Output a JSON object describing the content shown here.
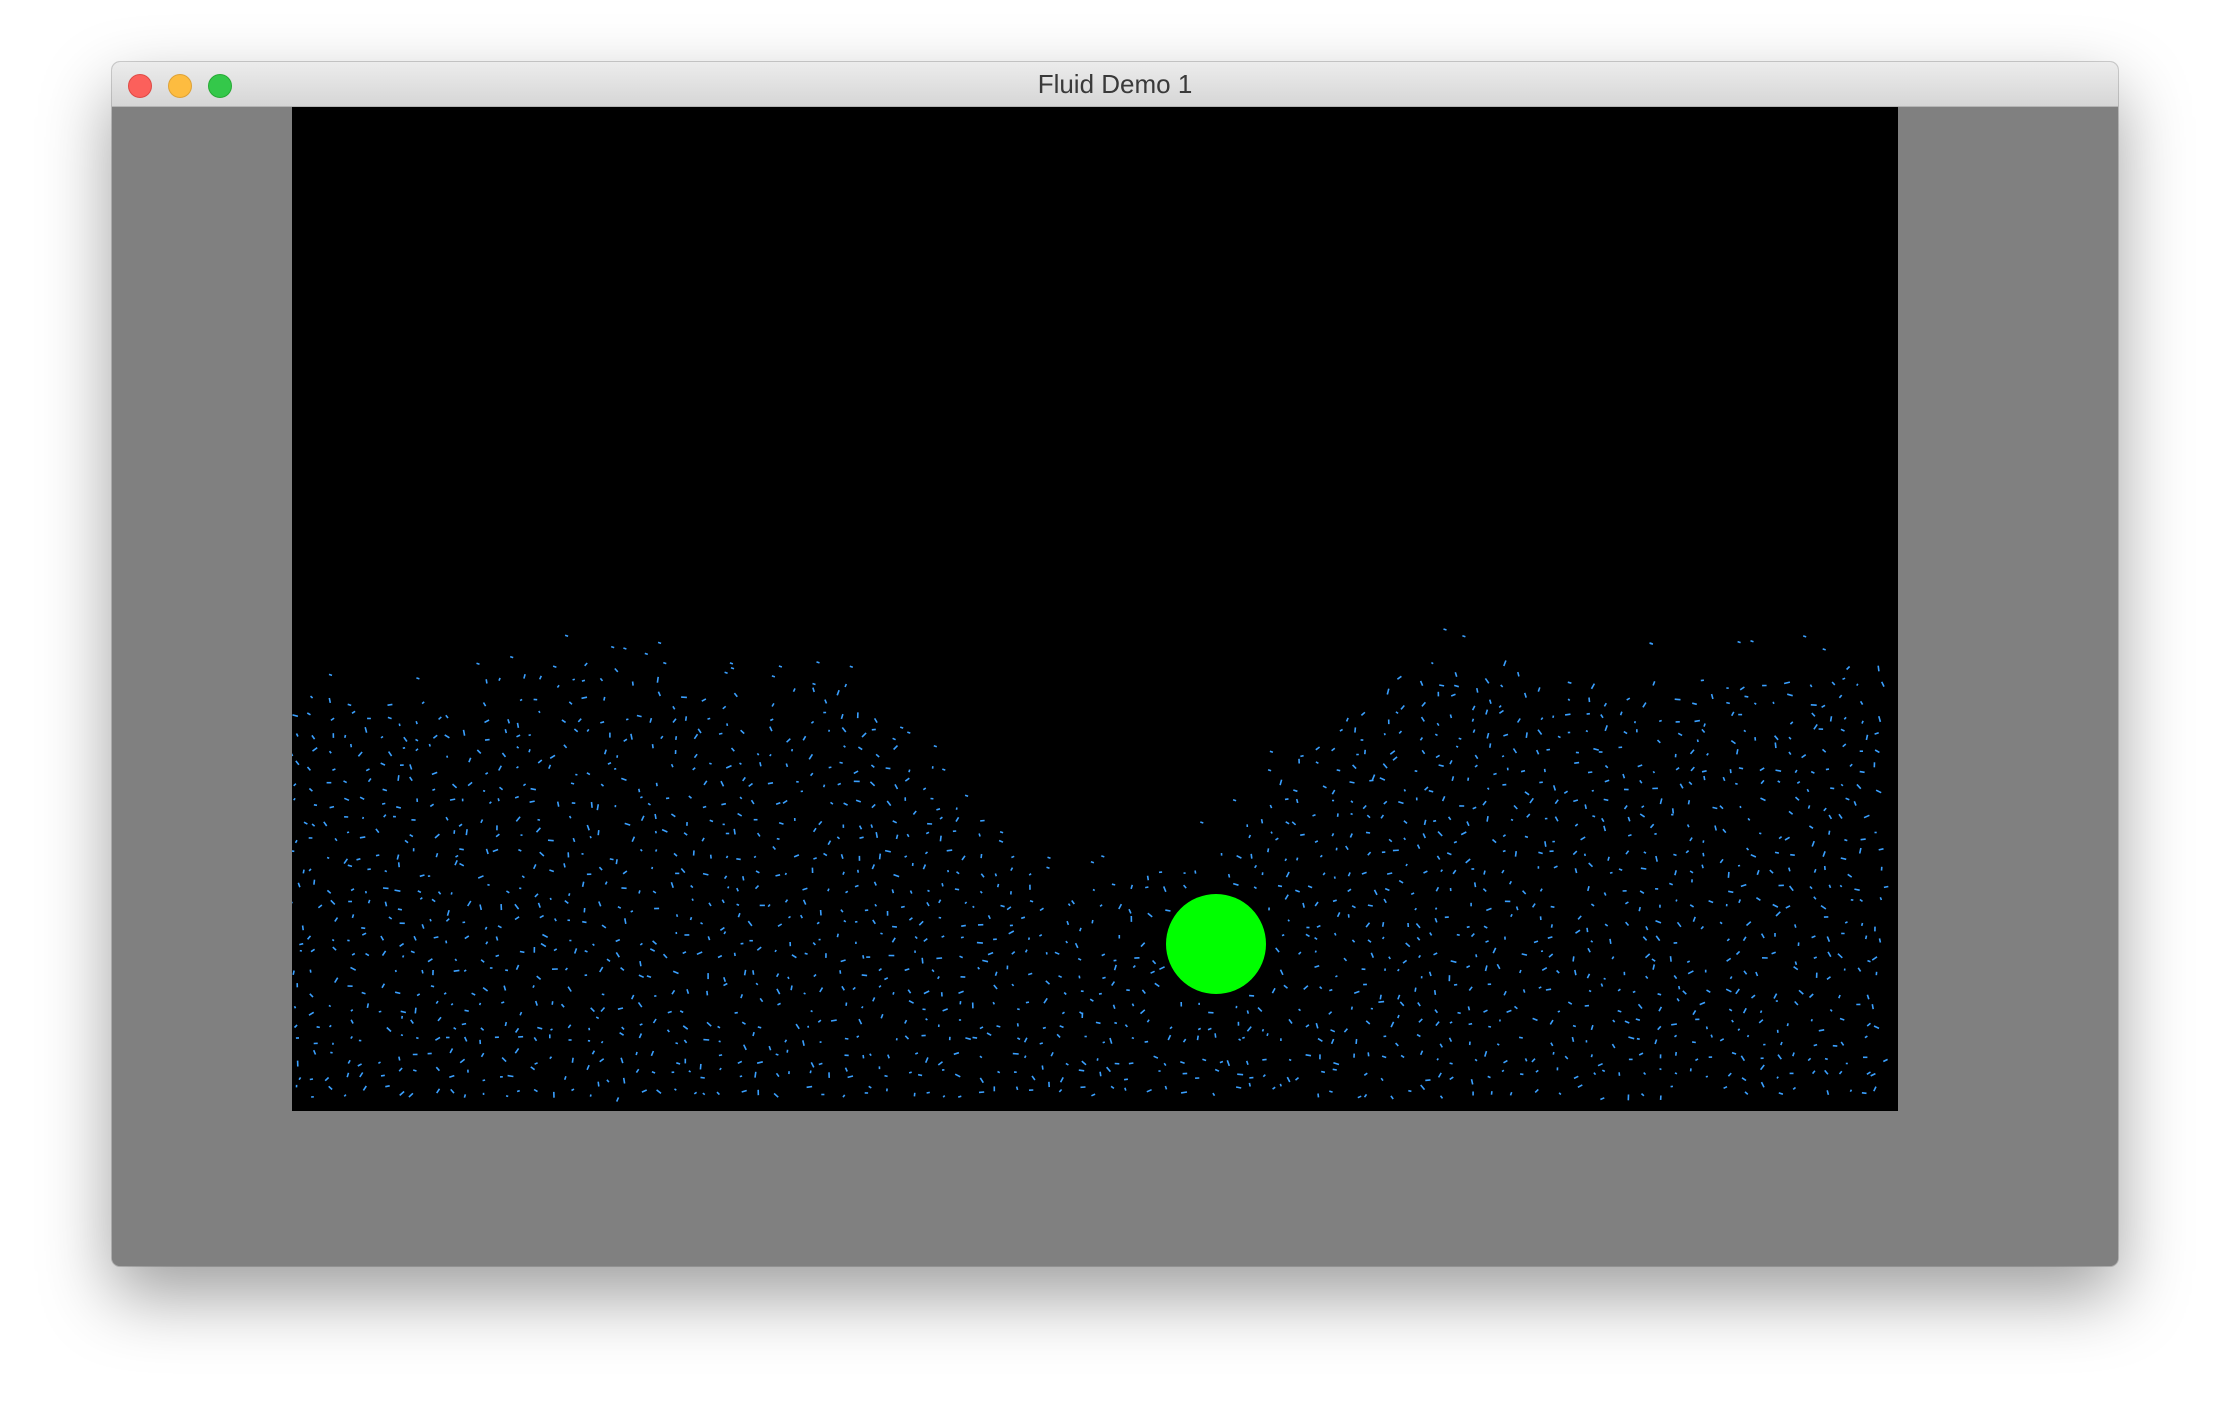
{
  "window": {
    "title": "Fluid Demo 1"
  },
  "colors": {
    "background_gray": "#808080",
    "canvas": "#000000",
    "particle": "#3aa0ff",
    "ball": "#00ff00"
  },
  "icons": {
    "close": "close-button",
    "minimize": "minimize-button",
    "maximize": "maximize-button"
  }
}
